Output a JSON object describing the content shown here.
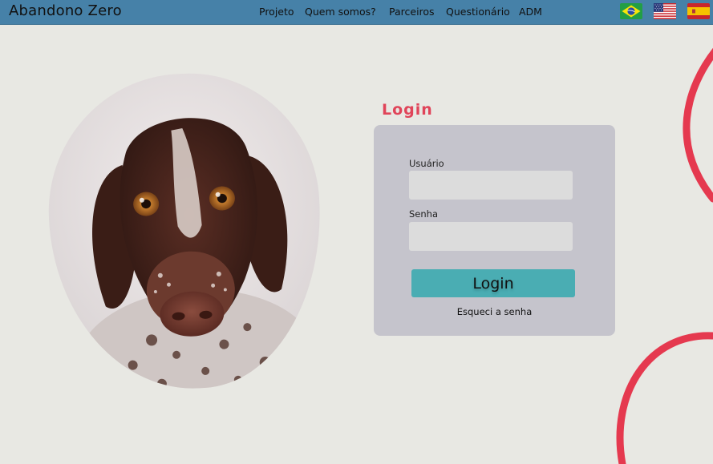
{
  "brand": "Abandono Zero",
  "nav": {
    "items": [
      "Projeto",
      "Quem somos?",
      "Parceiros",
      "Questionário",
      "ADM"
    ]
  },
  "languages": [
    {
      "code": "pt-BR",
      "icon": "brazil-flag-icon"
    },
    {
      "code": "en-US",
      "icon": "usa-flag-icon"
    },
    {
      "code": "es",
      "icon": "spain-flag-icon"
    }
  ],
  "login": {
    "title": "Login",
    "user_label": "Usuário",
    "user_value": "",
    "password_label": "Senha",
    "password_value": "",
    "submit_label": "Login",
    "forgot_label": "Esqueci a senha"
  },
  "colors": {
    "header": "#4681a8",
    "accent": "#e04459",
    "button": "#4aadb3",
    "panel": "#c5c4cc",
    "background": "#e8e8e3"
  }
}
